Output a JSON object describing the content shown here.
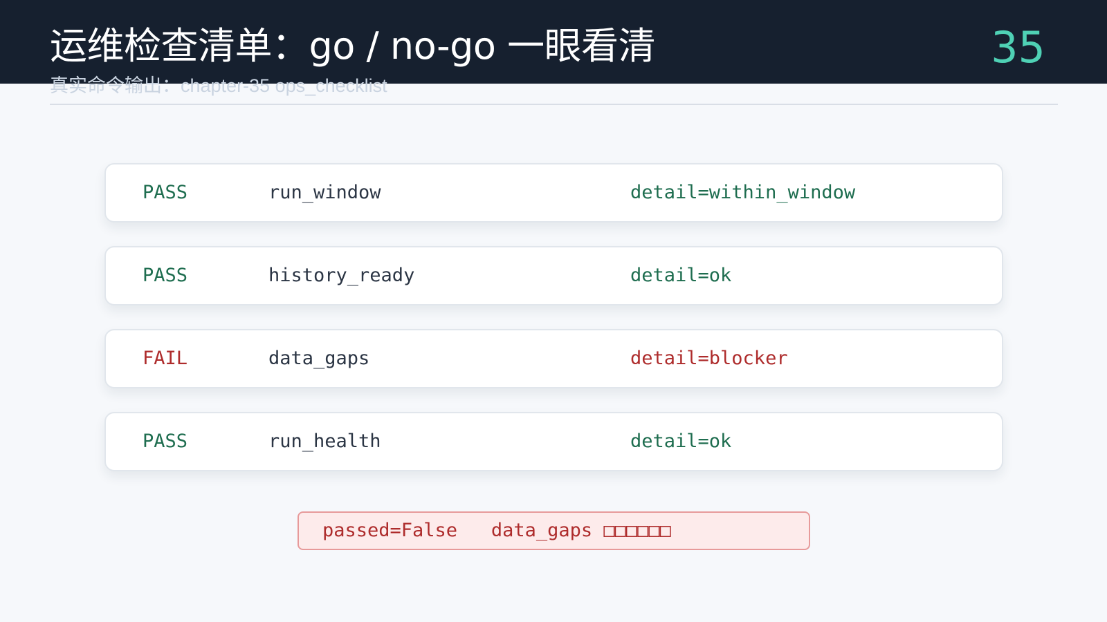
{
  "slide": {
    "title": "运维检查清单：go / no-go 一眼看清",
    "subtitle": "真实命令输出：chapter-35 ops_checklist",
    "page_number": "35"
  },
  "checks": [
    {
      "status": "PASS",
      "name": "run_window",
      "detail": "detail=within_window"
    },
    {
      "status": "PASS",
      "name": "history_ready",
      "detail": "detail=ok"
    },
    {
      "status": "FAIL",
      "name": "data_gaps",
      "detail": "detail=blocker"
    },
    {
      "status": "PASS",
      "name": "run_health",
      "detail": "detail=ok"
    }
  ],
  "summary": "passed=False   data_gaps □□□□□□",
  "colors": {
    "header_bg": "#16202f",
    "page_number": "#4fd1b5",
    "pass": "#1e6d4f",
    "fail": "#ae2c2c",
    "summary_bg": "#fdebeb"
  }
}
